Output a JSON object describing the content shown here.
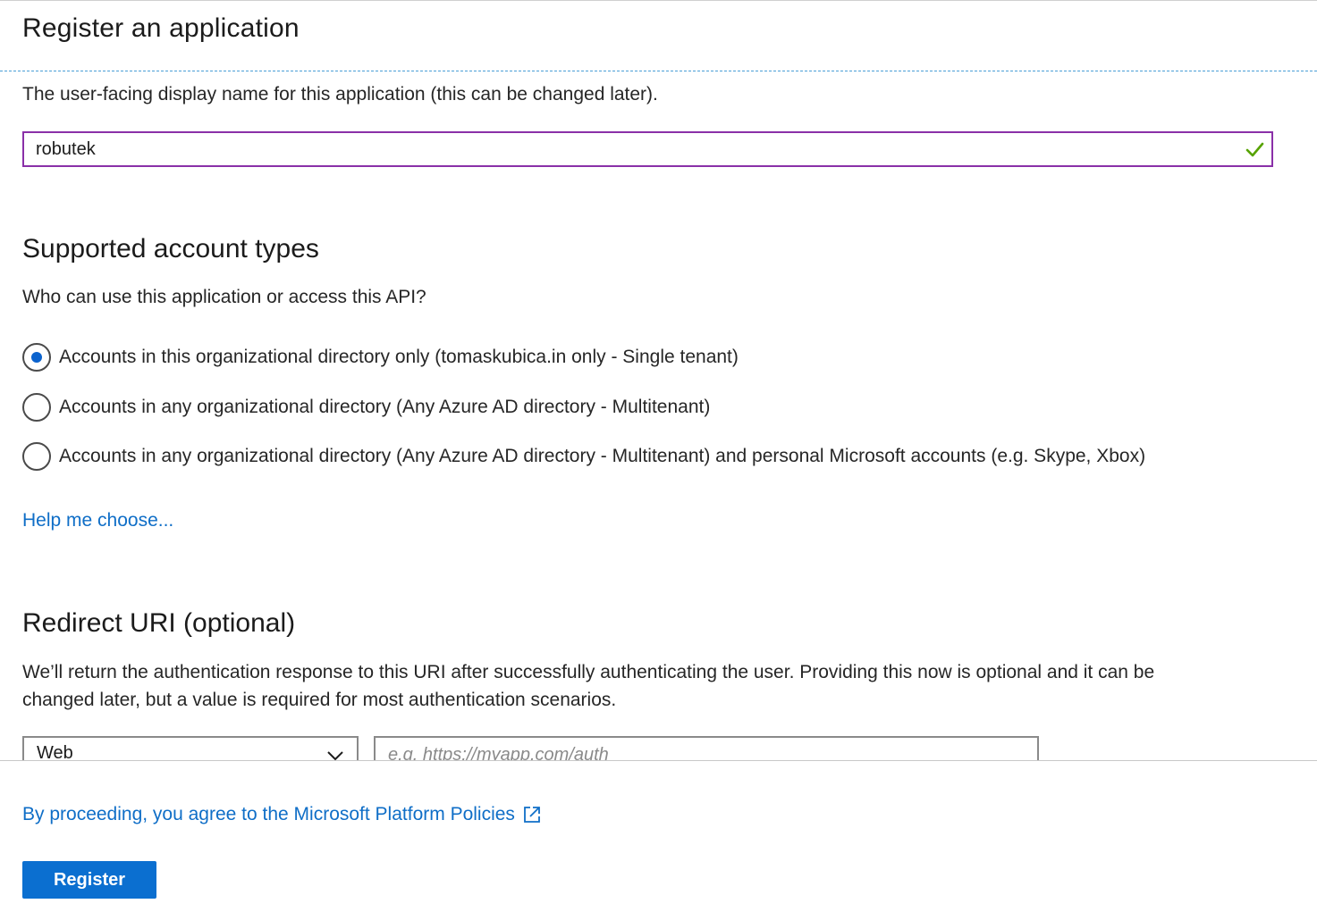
{
  "title": "Register an application",
  "name_section": {
    "description": "The user-facing display name for this application (this can be changed later).",
    "input_value": "robutek",
    "validation_icon": "check-icon"
  },
  "account_types": {
    "heading": "Supported account types",
    "question": "Who can use this application or access this API?",
    "options": [
      {
        "label": "Accounts in this organizational directory only (tomaskubica.in only - Single tenant)",
        "selected": true
      },
      {
        "label": "Accounts in any organizational directory (Any Azure AD directory - Multitenant)",
        "selected": false
      },
      {
        "label": "Accounts in any organizational directory (Any Azure AD directory - Multitenant) and personal Microsoft accounts (e.g. Skype, Xbox)",
        "selected": false
      }
    ],
    "help_link": "Help me choose..."
  },
  "redirect": {
    "heading": "Redirect URI (optional)",
    "description_line1": "We’ll return the authentication response to this URI after successfully authenticating the user. Providing this now is optional and it can be",
    "description_line2": "changed later, but a value is required for most authentication scenarios.",
    "platform_value": "Web",
    "uri_placeholder": "e.g. https://myapp.com/auth",
    "uri_value": ""
  },
  "footer": {
    "policy_text": "By proceeding, you agree to the Microsoft Platform Policies",
    "register_label": "Register"
  },
  "colors": {
    "accent": "#0b6fd0",
    "link": "#0f6ec7",
    "focus_border": "#8a30a8",
    "valid_check": "#57a300"
  }
}
